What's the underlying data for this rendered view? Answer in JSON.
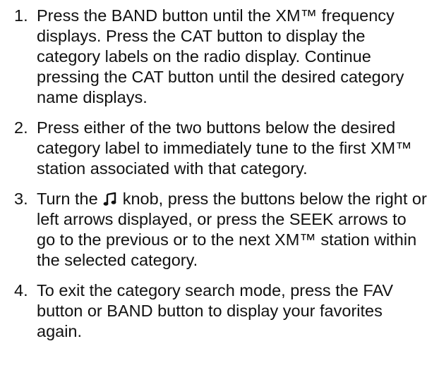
{
  "steps": [
    {
      "number": "1.",
      "text": "Press the BAND button until the XM™ frequency displays. Press the CAT button to display the category labels on the radio display. Continue pressing the CAT button until the desired category name displays."
    },
    {
      "number": "2.",
      "text": "Press either of the two buttons below the desired category label to immediately tune to the first XM™ station associated with that category."
    },
    {
      "number": "3.",
      "text_before_icon": "Turn the",
      "icon": "music-note-icon",
      "text_after_icon": "knob, press the buttons below the right or left arrows displayed, or press the SEEK arrows to go to the previous or to the next XM™ station within the selected category."
    },
    {
      "number": "4.",
      "text": "To exit the category search mode, press the FAV button or BAND button to display your favorites again."
    }
  ]
}
